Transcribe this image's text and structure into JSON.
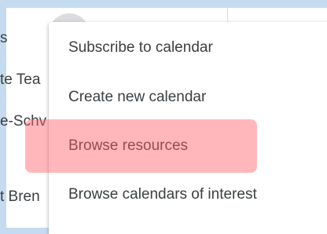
{
  "background": {
    "sidebar_fragments": [
      "s",
      "te Tea",
      "e-Schv",
      "t Bren"
    ]
  },
  "menu": {
    "items": [
      {
        "label": "Subscribe to calendar"
      },
      {
        "label": "Create new calendar"
      },
      {
        "label": "Browse resources",
        "highlighted": true
      },
      {
        "label": "Browse calendars of interest"
      }
    ]
  },
  "colors": {
    "page_background": "#c5dcf0",
    "highlight": "#ff5f69",
    "text": "#3c4043"
  }
}
